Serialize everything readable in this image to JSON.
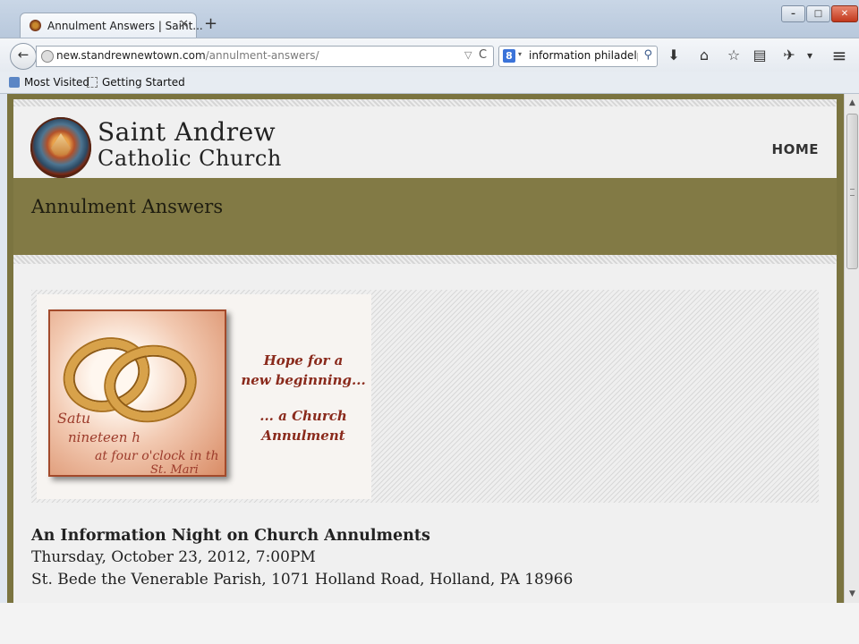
{
  "window": {
    "controls": {
      "minimize": "–",
      "maximize": "□",
      "close": "✕"
    }
  },
  "tab": {
    "title": "Annulment Answers | Saint...",
    "close": "✕",
    "new_tab": "+"
  },
  "nav": {
    "back": "←",
    "url_domain": "new.standrewnewtown.com",
    "url_path": "/annulment-answers/",
    "dropdown": "▽",
    "reload": "C",
    "search_engine": "8",
    "search_engine_dropdown": "▾",
    "search_text": "information philadelphia",
    "search_icon": "⚲",
    "toolbar": {
      "download": "⬇",
      "home": "⌂",
      "bookmark_star": "☆",
      "reading_list": "▤",
      "addon": "✈",
      "addon_dropdown": "▾",
      "menu": "≡"
    }
  },
  "bookmarks": [
    {
      "label": "Most Visited"
    },
    {
      "label": "Getting Started"
    }
  ],
  "site": {
    "name_line1": "Saint Andrew",
    "name_line2": "Catholic Church",
    "nav_home": "HOME"
  },
  "page": {
    "title": "Annulment Answers",
    "flyer": {
      "photo_text": [
        "Satu",
        "nineteen h",
        "at four o'clock in th",
        "St. Mari"
      ],
      "tagline_1": "Hope for a",
      "tagline_2": "new beginning...",
      "tagline_3": "... a Church",
      "tagline_4": "Annulment"
    },
    "event": {
      "heading": "An Information Night on Church Annulments",
      "date": "Thursday, October 23, 2012, 7:00PM",
      "location": "St. Bede the Venerable Parish, 1071 Holland Road, Holland, PA 18966"
    }
  },
  "scrollbar": {
    "up": "▲",
    "down": "▼"
  },
  "colors": {
    "banner": "#827a45",
    "frame": "#7b7440",
    "script_red": "#9c3b2b"
  }
}
